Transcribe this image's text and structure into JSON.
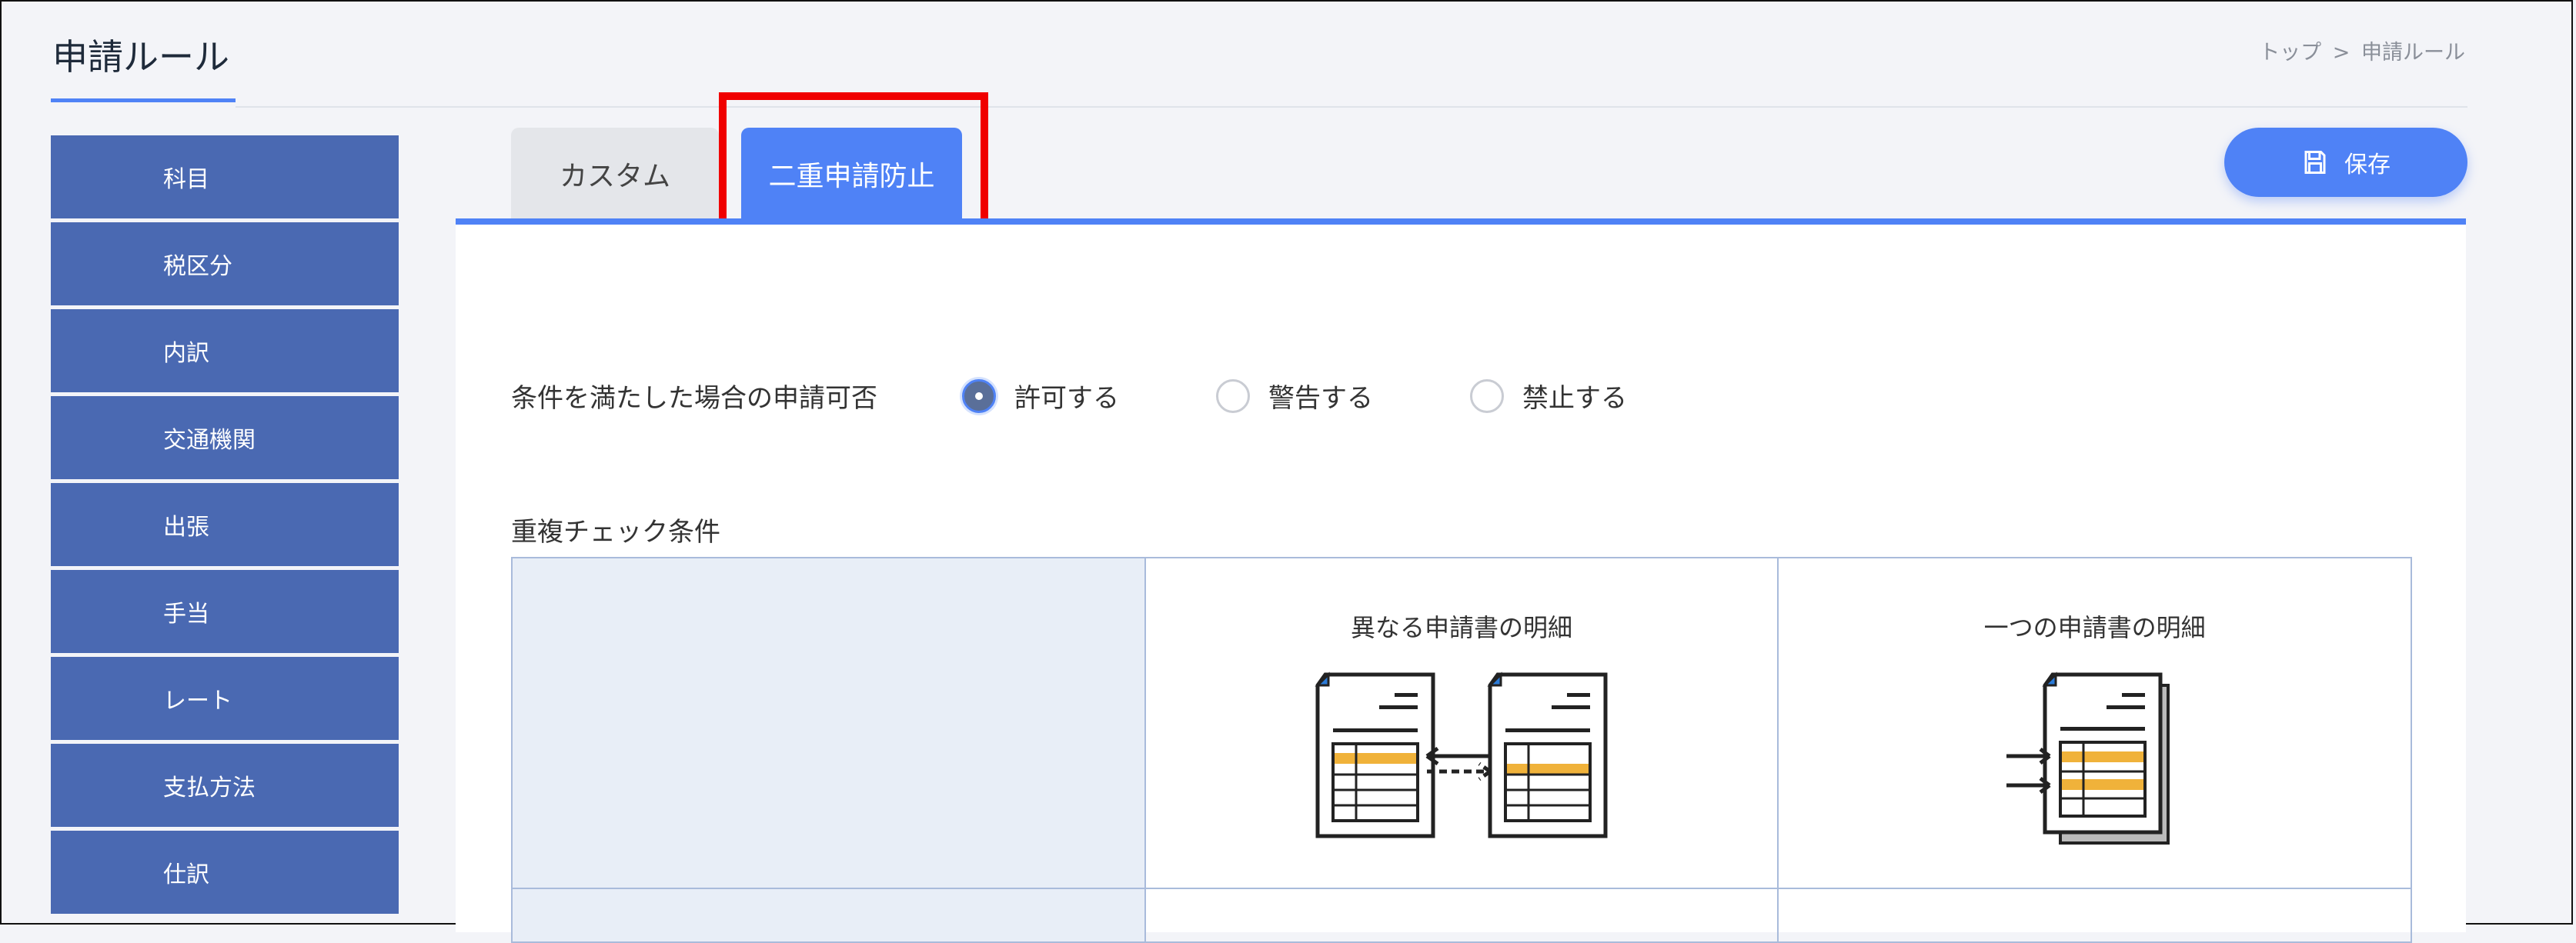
{
  "header": {
    "title": "申請ルール",
    "breadcrumb": {
      "home": "トップ",
      "separator": ">",
      "current": "申請ルール"
    }
  },
  "sidebar": {
    "items": [
      {
        "label": "科目"
      },
      {
        "label": "税区分"
      },
      {
        "label": "内訳"
      },
      {
        "label": "交通機関"
      },
      {
        "label": "出張"
      },
      {
        "label": "手当"
      },
      {
        "label": "レート"
      },
      {
        "label": "支払方法"
      },
      {
        "label": "仕訳"
      }
    ]
  },
  "tabs": {
    "custom": "カスタム",
    "duplicate": "二重申請防止"
  },
  "toolbar": {
    "save_label": "保存",
    "save_icon": "save-icon"
  },
  "condition": {
    "label": "条件を満たした場合の申請可否",
    "options": [
      {
        "label": "許可する",
        "checked": true
      },
      {
        "label": "警告する",
        "checked": false
      },
      {
        "label": "禁止する",
        "checked": false
      }
    ]
  },
  "check": {
    "label": "重複チェック条件",
    "columns": [
      {
        "label": "異なる申請書の明細",
        "icon": "two-documents-compare-icon"
      },
      {
        "label": "一つの申請書の明細",
        "icon": "single-document-stack-icon"
      }
    ]
  },
  "colors": {
    "accent": "#4f82f6",
    "sidebar": "#4a69b2",
    "highlight": "#f00000"
  }
}
